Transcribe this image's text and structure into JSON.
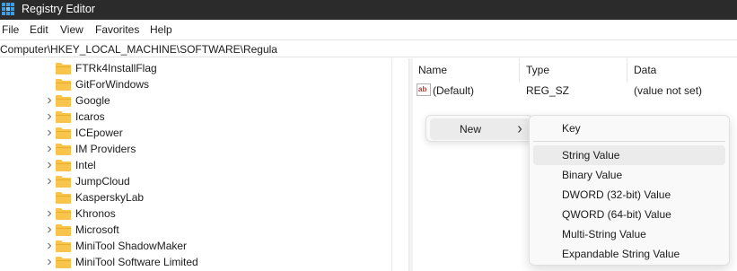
{
  "window": {
    "title": "Registry Editor"
  },
  "menu": [
    "File",
    "Edit",
    "View",
    "Favorites",
    "Help"
  ],
  "address": "Computer\\HKEY_LOCAL_MACHINE\\SOFTWARE\\Regula",
  "tree": {
    "items": [
      {
        "label": "FTRk4InstallFlag",
        "has_children": false
      },
      {
        "label": "GitForWindows",
        "has_children": false
      },
      {
        "label": "Google",
        "has_children": true
      },
      {
        "label": "Icaros",
        "has_children": true
      },
      {
        "label": "ICEpower",
        "has_children": true
      },
      {
        "label": "IM Providers",
        "has_children": true
      },
      {
        "label": "Intel",
        "has_children": true
      },
      {
        "label": "JumpCloud",
        "has_children": true
      },
      {
        "label": "KasperskyLab",
        "has_children": false
      },
      {
        "label": "Khronos",
        "has_children": true
      },
      {
        "label": "Microsoft",
        "has_children": true
      },
      {
        "label": "MiniTool ShadowMaker",
        "has_children": true
      },
      {
        "label": "MiniTool Software Limited",
        "has_children": true
      }
    ]
  },
  "list": {
    "columns": [
      "Name",
      "Type",
      "Data"
    ],
    "rows": [
      {
        "name": "(Default)",
        "type": "REG_SZ",
        "data": "(value not set)",
        "icon": "string-value-icon"
      }
    ]
  },
  "context_menu": {
    "new_label": "New",
    "submenu": [
      "Key",
      "String Value",
      "Binary Value",
      "DWORD (32-bit) Value",
      "QWORD (64-bit) Value",
      "Multi-String Value",
      "Expandable String Value"
    ],
    "highlighted": "String Value"
  },
  "colors": {
    "titlebar_bg": "#2b2b2b",
    "folder": "#f8c44c",
    "menu_hover": "#ebebeb",
    "app_icon": "#3aa0e6"
  }
}
